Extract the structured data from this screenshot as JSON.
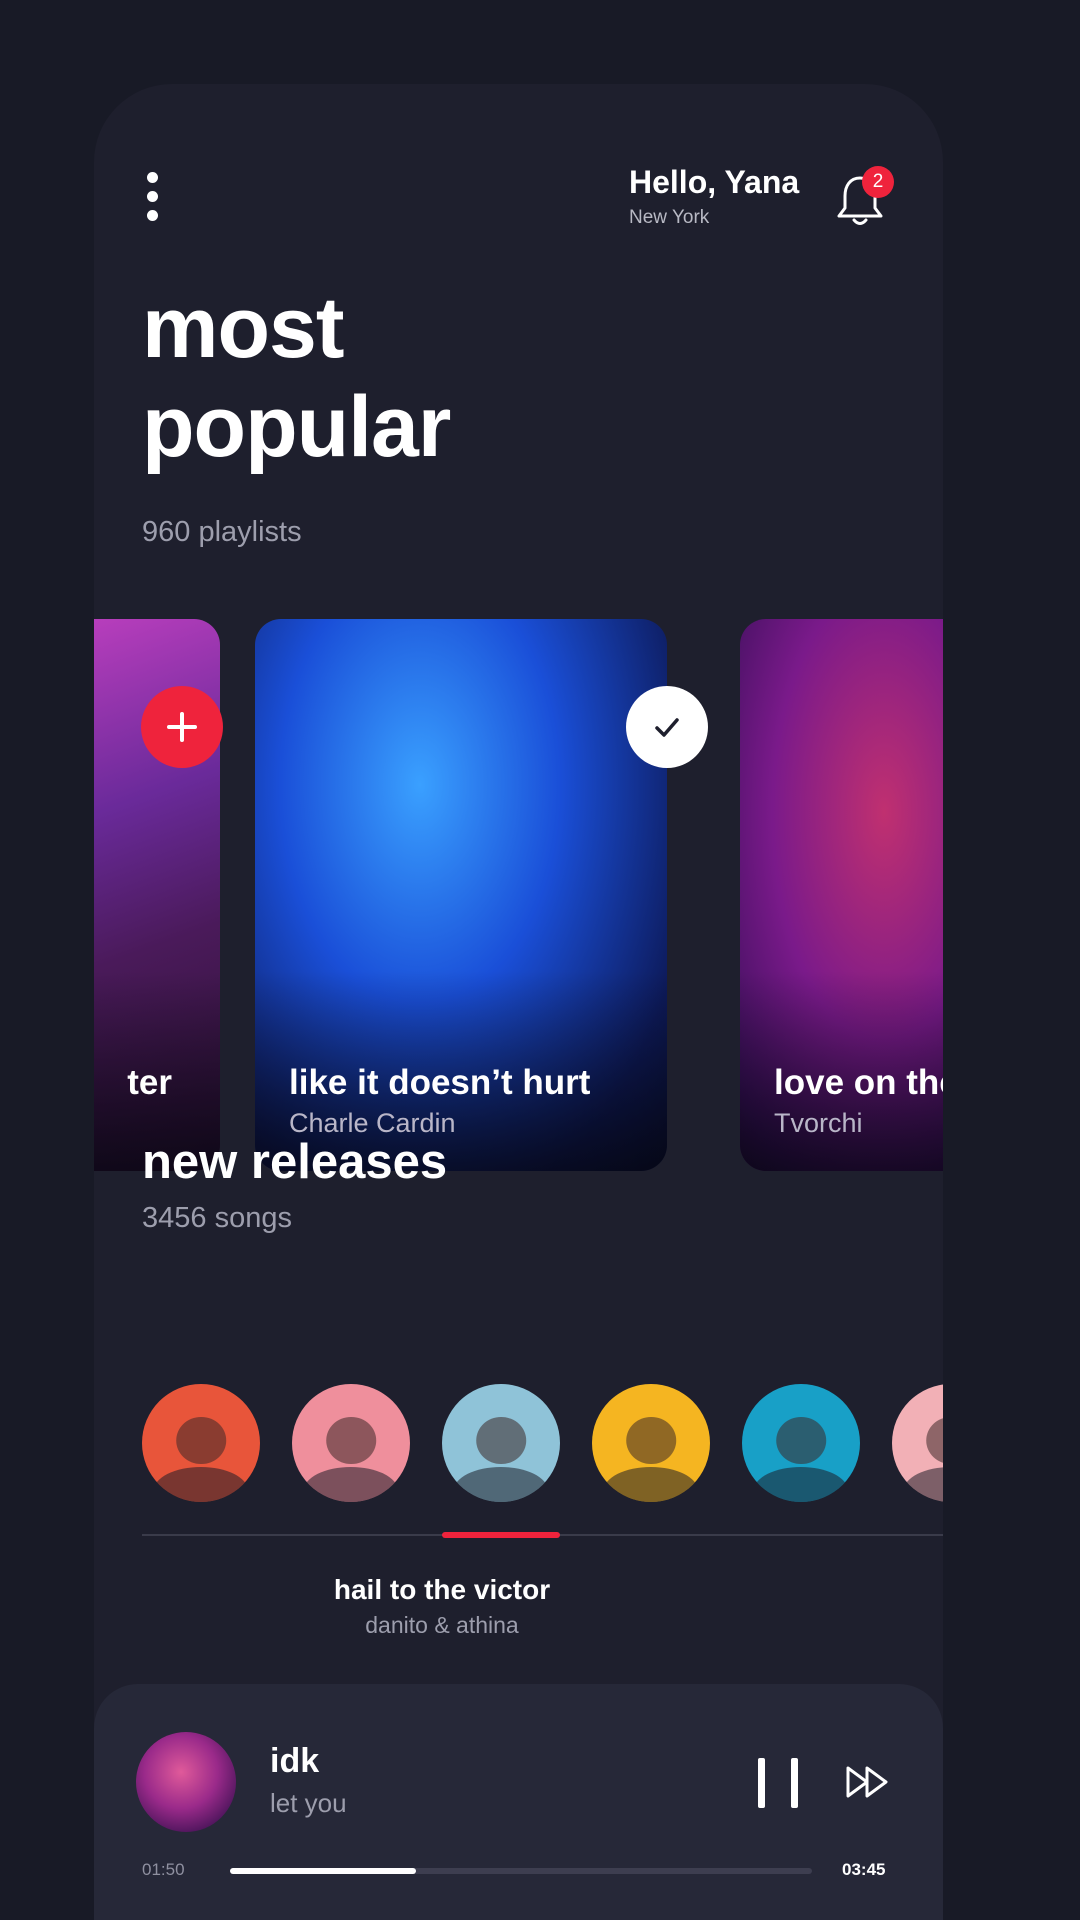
{
  "header": {
    "greeting": "Hello, Yana",
    "location": "New York",
    "notification_count": "2"
  },
  "popular": {
    "title_line1": "most",
    "title_line2": "popular",
    "count_label": "960 playlists",
    "cards": [
      {
        "title": "ter",
        "artist": "",
        "action": "add"
      },
      {
        "title": "like it doesn’t hurt",
        "artist": "Charle Cardin",
        "action": "added"
      },
      {
        "title": "love on the brain",
        "artist": "Tvorchi",
        "action": ""
      }
    ]
  },
  "releases": {
    "title": "new releases",
    "count_label": "3456 songs",
    "avatar_colors": [
      "#e8553a",
      "#ef8f9c",
      "#8fc3d8",
      "#f5b521",
      "#18a0c7",
      "#f2b0b6"
    ],
    "active_index": 2,
    "selected_title": "hail to the victor",
    "selected_artist": "danito & athina"
  },
  "player": {
    "title": "idk",
    "artist": "let you",
    "elapsed": "01:50",
    "duration": "03:45",
    "progress": 0.32
  },
  "colors": {
    "accent": "#ef233c",
    "background": "#181a26",
    "surface": "#1e1f2d",
    "player_surface": "#262838"
  }
}
